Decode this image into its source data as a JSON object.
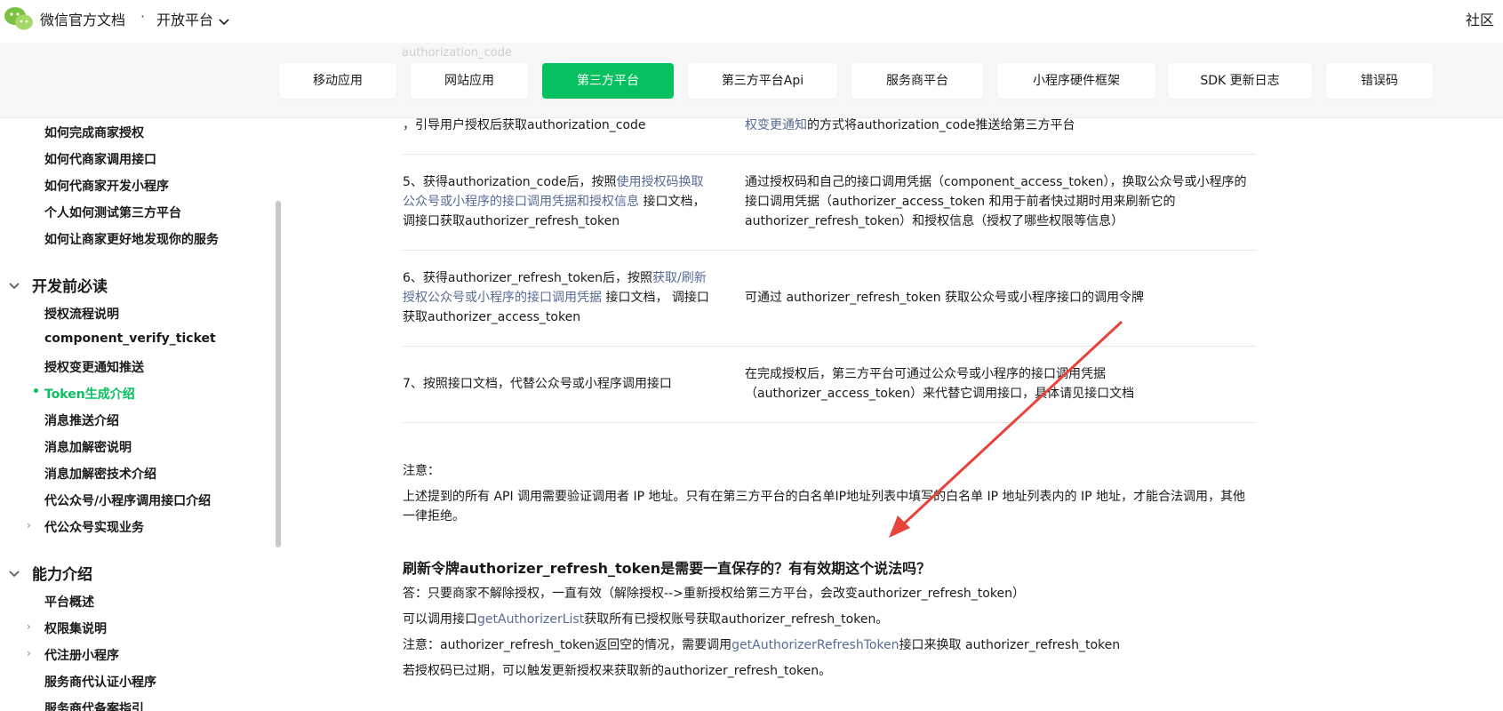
{
  "header": {
    "site_title": "微信官方文档",
    "dot": "·",
    "platform": "开放平台",
    "community": "社区"
  },
  "tabs": [
    {
      "label": "移动应用"
    },
    {
      "label": "网站应用"
    },
    {
      "label": "第三方平台"
    },
    {
      "label": "第三方平台Api"
    },
    {
      "label": "服务商平台"
    },
    {
      "label": "小程序硬件框架"
    },
    {
      "label": "SDK 更新日志"
    },
    {
      "label": "错误码"
    }
  ],
  "tab_ghost": "authorization_code",
  "sidebar": {
    "items_top": [
      {
        "label": "如何完成商家授权"
      },
      {
        "label": "如何代商家调用接口"
      },
      {
        "label": "如何代商家开发小程序"
      },
      {
        "label": "个人如何测试第三方平台"
      },
      {
        "label": "如何让商家更好地发现你的服务"
      }
    ],
    "section_dev": "开发前必读",
    "items_dev": [
      {
        "label": "授权流程说明"
      },
      {
        "label": "component_verify_ticket"
      },
      {
        "label": "授权变更通知推送"
      },
      {
        "label": "Token生成介绍"
      },
      {
        "label": "消息推送介绍"
      },
      {
        "label": "消息加解密说明"
      },
      {
        "label": "消息加解密技术介绍"
      },
      {
        "label": "代公众号/小程序调用接口介绍"
      },
      {
        "label": "代公众号实现业务"
      }
    ],
    "section_ability": "能力介绍",
    "items_ability": [
      {
        "label": "平台概述"
      },
      {
        "label": "权限集说明"
      },
      {
        "label": "代注册小程序"
      },
      {
        "label": "服务商代认证小程序"
      },
      {
        "label": "服务商代备案指引"
      }
    ]
  },
  "table": {
    "row4": {
      "left": "，引导用户授权后获取authorization_code",
      "right_link": "权变更通知",
      "right_rest": "的方式将authorization_code推送给第三方平台"
    },
    "row5": {
      "left_a": "5、获得authorization_code后，按照",
      "left_link": "使用授权码换取公众号或小程序的接口调用凭据和授权信息",
      "left_b": " 接口文档，调接口获取authorizer_refresh_token",
      "right": "通过授权码和自己的接口调用凭据（component_access_token），换取公众号或小程序的接口调用凭据（authorizer_access_token 和用于前者快过期时用来刷新它的authorizer_refresh_token）和授权信息（授权了哪些权限等信息）"
    },
    "row6": {
      "left_a": "6、获得authorizer_refresh_token后，按照",
      "left_link": "获取/刷新授权公众号或小程序的接口调用凭据",
      "left_b": " 接口文档， 调接口获取authorizer_access_token",
      "right": "可通过 authorizer_refresh_token 获取公众号或小程序接口的调用令牌"
    },
    "row7": {
      "left": "7、按照接口文档，代替公众号或小程序调用接口",
      "right": "在完成授权后，第三方平台可通过公众号或小程序的接口调用凭据（authorizer_access_token）来代替它调用接口，具体请见接口文档"
    }
  },
  "note": {
    "title": "注意：",
    "body": "上述提到的所有 API 调用需要验证调用者 IP 地址。只有在第三方平台的白名单IP地址列表中填写的白名单 IP 地址列表内的 IP 地址，才能合法调用，其他一律拒绝。"
  },
  "faq": {
    "title": "刷新令牌authorizer_refresh_token是需要一直保存的？有有效期这个说法吗？",
    "line1": "答：只要商家不解除授权，一直有效（解除授权-->重新授权给第三方平台，会改变authorizer_refresh_token）",
    "line2_a": "可以调用接口",
    "line2_link": "getAuthorizerList",
    "line2_b": "获取所有已授权账号获取authorizer_refresh_token。",
    "line3_a": "注意：authorizer_refresh_token返回空的情况，需要调用",
    "line3_link": "getAuthorizerRefreshToken",
    "line3_b": "接口来换取 authorizer_refresh_token",
    "line4": "若授权码已过期，可以触发更新授权来获取新的authorizer_refresh_token。"
  },
  "colors": {
    "brand_green": "#07c160",
    "link": "#576b95",
    "annotation_red": "#e8433a"
  },
  "icons": {
    "logo": "wechat-logo",
    "platform_chevron": "chevron-down-icon",
    "section_caret": "chevron-down-icon",
    "item_expander": "chevron-right-icon"
  }
}
